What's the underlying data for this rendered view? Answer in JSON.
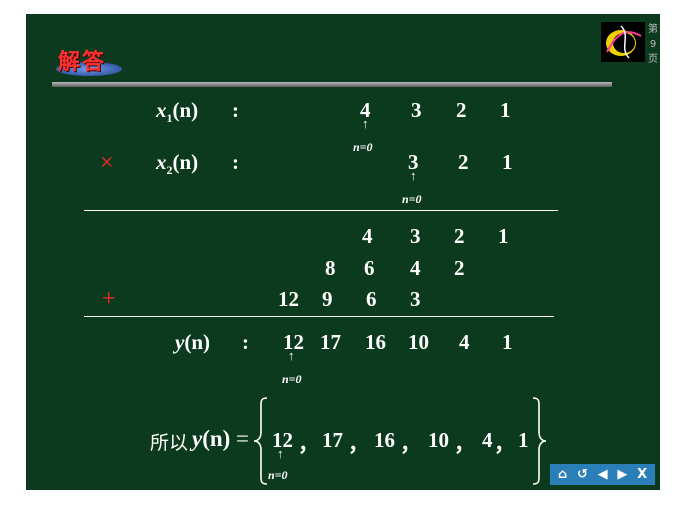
{
  "header": {
    "badge_text": "解答",
    "page_label_top": "第",
    "page_number": "9",
    "page_label_bottom": "页"
  },
  "rows": {
    "x1": {
      "symbol": "x",
      "sub": "1",
      "arg": "(n)",
      "colon": ":",
      "values": [
        "4",
        "3",
        "2",
        "1"
      ],
      "marker": "n=0"
    },
    "x2": {
      "multiply": "×",
      "symbol": "x",
      "sub": "2",
      "arg": "(n)",
      "colon": ":",
      "values": [
        "3",
        "2",
        "1"
      ],
      "marker": "n=0"
    },
    "partial1": [
      "4",
      "3",
      "2",
      "1"
    ],
    "partial2": [
      "8",
      "6",
      "4",
      "2"
    ],
    "partial3": {
      "plus": "+",
      "values": [
        "12",
        "9",
        "6",
        "3"
      ]
    },
    "y": {
      "symbol": "y",
      "arg": "(n)",
      "colon": ":",
      "values": [
        "12",
        "17",
        "16",
        "10",
        "4",
        "1"
      ],
      "marker": "n=0"
    }
  },
  "conclusion": {
    "prefix": "所以",
    "symbol": "y",
    "arg": "(n)",
    "equals": "=",
    "items": [
      "12",
      "17",
      "16",
      "10",
      "4",
      "1"
    ],
    "separator": "，",
    "marker": "n=0"
  },
  "nav": {
    "home": "⌂",
    "back": "↺",
    "prev": "◀",
    "next": "▶",
    "close": "X"
  },
  "colors": {
    "board": "#0c3a1e",
    "accent_red": "#ff2a2a",
    "nav_blue": "#2b7fb8"
  },
  "icons": [
    "home-icon",
    "return-icon",
    "previous-icon",
    "next-icon",
    "close-icon"
  ]
}
